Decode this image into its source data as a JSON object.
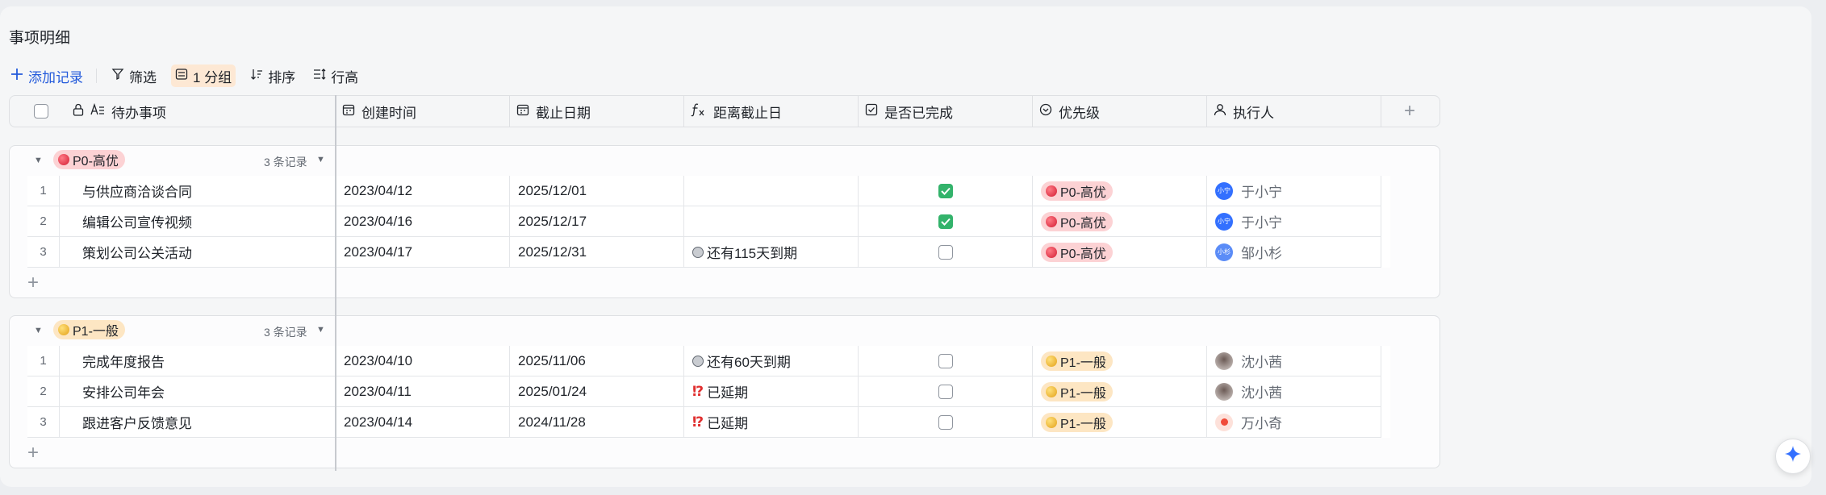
{
  "page": {
    "title": "事项明细"
  },
  "toolbar": {
    "add": "添加记录",
    "filter": "筛选",
    "group": "1 分组",
    "sort": "排序",
    "row_height": "行高"
  },
  "columns": {
    "task": "待办事项",
    "created": "创建时间",
    "deadline": "截止日期",
    "remaining": "距离截止日",
    "done": "是否已完成",
    "priority": "优先级",
    "owner": "执行人"
  },
  "groups": [
    {
      "tag": "P0-高优",
      "color": "#d31d33",
      "count_label": "3 条记录",
      "rows": [
        {
          "num": "1",
          "task": "与供应商洽谈合同",
          "created": "2023/04/12",
          "deadline": "2025/12/01",
          "remaining": "",
          "status_icon": "none",
          "done": true,
          "priority": "P0-高优",
          "owner": "于小宁",
          "avatar_text": "小宁"
        },
        {
          "num": "2",
          "task": "编辑公司宣传视频",
          "created": "2023/04/16",
          "deadline": "2025/12/17",
          "remaining": "",
          "status_icon": "none",
          "done": true,
          "priority": "P0-高优",
          "owner": "于小宁",
          "avatar_text": "小宁"
        },
        {
          "num": "3",
          "task": "策划公司公关活动",
          "created": "2023/04/17",
          "deadline": "2025/12/31",
          "remaining": "还有115天到期",
          "status_icon": "clock-icon",
          "done": false,
          "priority": "P0-高优",
          "owner": "邹小杉",
          "avatar_text": "小杉"
        }
      ]
    },
    {
      "tag": "P1-一般",
      "color": "#e3a11a",
      "count_label": "3 条记录",
      "rows": [
        {
          "num": "1",
          "task": "完成年度报告",
          "created": "2023/04/10",
          "deadline": "2025/11/06",
          "remaining": "还有60天到期",
          "status_icon": "clock-icon",
          "done": false,
          "priority": "P1-一般",
          "owner": "沈小茜",
          "avatar_text": ""
        },
        {
          "num": "2",
          "task": "安排公司年会",
          "created": "2023/04/11",
          "deadline": "2025/01/24",
          "remaining": "已延期",
          "status_icon": "warning-icon",
          "done": false,
          "priority": "P1-一般",
          "owner": "沈小茜",
          "avatar_text": ""
        },
        {
          "num": "3",
          "task": "跟进客户反馈意见",
          "created": "2023/04/14",
          "deadline": "2024/11/28",
          "remaining": "已延期",
          "status_icon": "warning-icon",
          "done": false,
          "priority": "P1-一般",
          "owner": "万小奇",
          "avatar_text": ""
        }
      ]
    }
  ]
}
